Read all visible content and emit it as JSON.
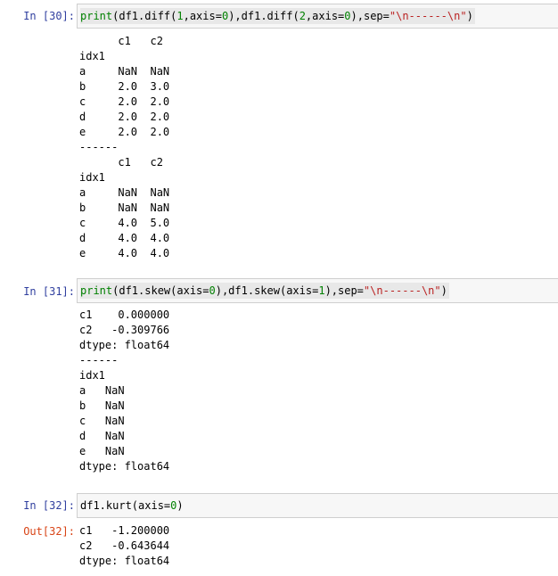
{
  "cells": [
    {
      "in_prompt": "In  [30]:",
      "code": {
        "func": "print",
        "p1": "(df1.diff(",
        "n1": "1",
        "p2": ",axis=",
        "n2": "0",
        "p3": "),df1.diff(",
        "n3": "2",
        "p4": ",axis=",
        "n4": "0",
        "p5": "),sep=",
        "s1": "\"\\n------\\n\"",
        "p6": ")"
      },
      "output": "      c1   c2\nidx1\na     NaN  NaN\nb     2.0  3.0\nc     2.0  2.0\nd     2.0  2.0\ne     2.0  2.0\n------\n      c1   c2\nidx1\na     NaN  NaN\nb     NaN  NaN\nc     4.0  5.0\nd     4.0  4.0\ne     4.0  4.0"
    },
    {
      "in_prompt": "In  [31]:",
      "code": {
        "func": "print",
        "p1": "(df1.skew(axis=",
        "n1": "0",
        "p2": "),df1.skew(axis=",
        "n2": "1",
        "p3": "),sep=",
        "s1": "\"\\n------\\n\"",
        "p4": ")"
      },
      "output": "c1    0.000000\nc2   -0.309766\ndtype: float64\n------\nidx1\na   NaN\nb   NaN\nc   NaN\nd   NaN\ne   NaN\ndtype: float64"
    },
    {
      "in_prompt": "In  [32]:",
      "out_prompt": "Out[32]:",
      "code": {
        "p1": "df1.kurt(axis=",
        "n1": "0",
        "p2": ")"
      },
      "output": "c1   -1.200000\nc2   -0.643644\ndtype: float64"
    }
  ],
  "colors": {
    "in_prompt": "#303F9F",
    "out_prompt": "#D84315",
    "builtin": "#008000",
    "number": "#008000",
    "string": "#BA2121",
    "input_bg": "#f7f7f7",
    "input_border": "#cfcfcf"
  }
}
